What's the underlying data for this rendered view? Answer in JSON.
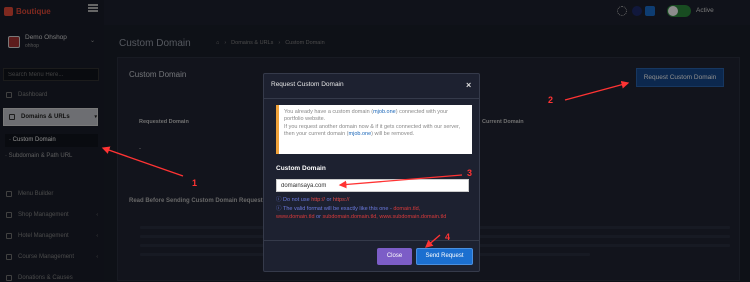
{
  "brand": {
    "name": "Boutique"
  },
  "user": {
    "name": "Demo Ohshop",
    "role": "ohhop"
  },
  "search": {
    "placeholder": "Search Menu Here..."
  },
  "nav": {
    "dashboard": "Dashboard",
    "domains": "Domains & URLs",
    "custom_domain": "Custom Domain",
    "subdomain": "Subdomain & Path URL",
    "menu_builder": "Menu Builder",
    "shop": "Shop Management",
    "hotel": "Hotel Management",
    "course": "Course Management",
    "donations": "Donations & Causes"
  },
  "topbar": {
    "active_label": "Active"
  },
  "page": {
    "title": "Custom Domain",
    "breadcrumb": [
      "Domains & URLs",
      "Custom Domain"
    ]
  },
  "card": {
    "title": "Custom Domain",
    "request_button": "Request Custom Domain",
    "col_requested": "Requested Domain",
    "col_current": "Current Domain",
    "empty_value": "-",
    "read_title": "Read Before Sending Custom Domain Request"
  },
  "modal": {
    "title": "Request Custom Domain",
    "close_glyph": "×",
    "alert_line1a": "You already have a custom domain (",
    "alert_kw1": "mjob.one",
    "alert_line1b": ") connected with your portfolio website.",
    "alert_line2a": "If you request another domain now & if it gets connected with our server, then your current domain (",
    "alert_kw2": "mjob.one",
    "alert_line2b": ") will be removed.",
    "field_label": "Custom Domain",
    "field_value": "domainsaya.com",
    "hint1a": "Do not use ",
    "hint1_http": "http://",
    "hint1_or": " or ",
    "hint1_https": "https://",
    "hint2a": "The valid format will be exactly like this one - ",
    "hint2_fmt1": "domain.tld,",
    "hint2_fmt2": "www.domain.tld",
    "hint2_or": " or ",
    "hint2_fmt3": "subdomain.domain.tld, www.subdomain.domain.tld",
    "close_button": "Close",
    "send_button": "Send Request"
  },
  "annotations": [
    "1",
    "2",
    "3",
    "4"
  ],
  "colors": {
    "accent": "#1b6fd0",
    "annotation": "#ff3333",
    "toggle": "#2c8a3c",
    "close": "#7c5dc7"
  }
}
